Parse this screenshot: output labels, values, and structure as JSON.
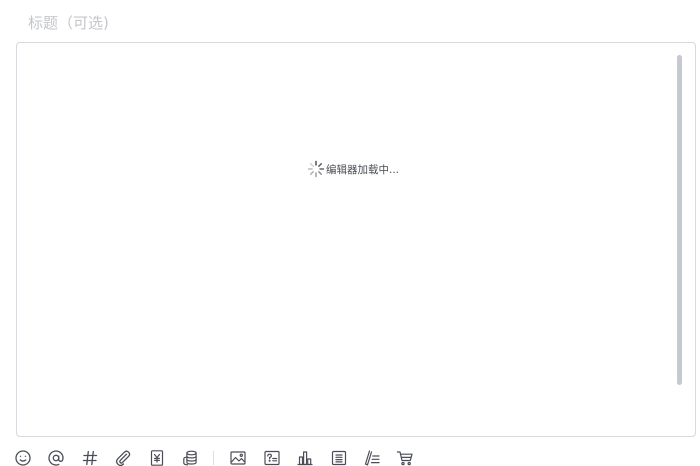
{
  "title": {
    "placeholder": "标题（可选)"
  },
  "editor": {
    "loading_text": "编辑器加载中..."
  },
  "toolbar": {
    "items": [
      {
        "icon": "emoji-icon"
      },
      {
        "icon": "mention-icon"
      },
      {
        "icon": "hashtag-icon"
      },
      {
        "icon": "attachment-icon"
      },
      {
        "icon": "paid-content-icon"
      },
      {
        "icon": "coins-icon"
      },
      {
        "icon": "image-icon"
      },
      {
        "icon": "question-icon"
      },
      {
        "icon": "chart-icon"
      },
      {
        "icon": "document-icon"
      },
      {
        "icon": "pen-list-icon"
      },
      {
        "icon": "cart-icon"
      }
    ]
  }
}
